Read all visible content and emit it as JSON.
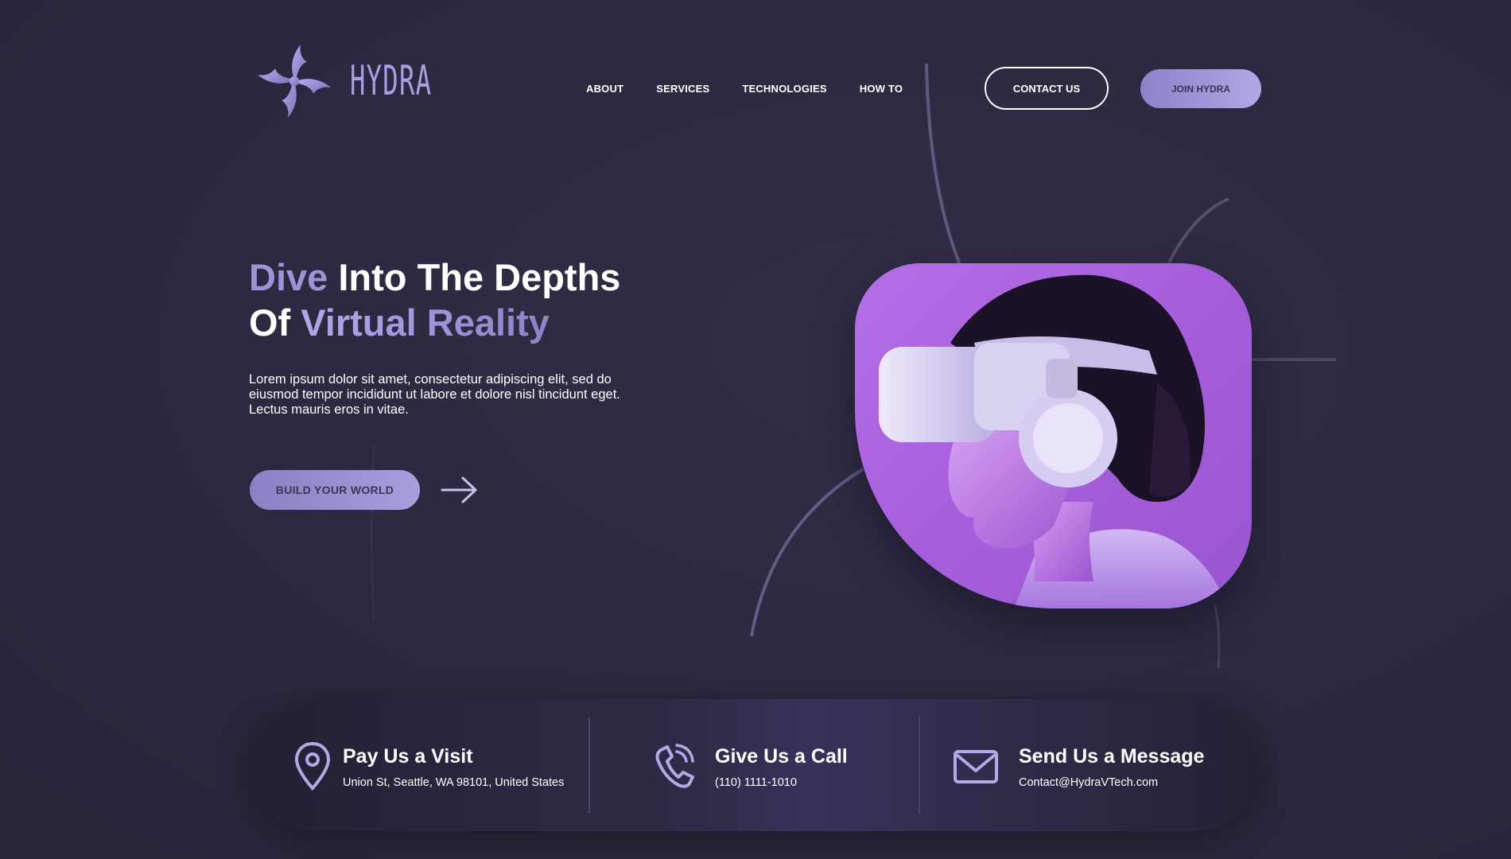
{
  "brand": {
    "name": "HYDRA",
    "logo_icon": "hydra-swirl-icon"
  },
  "nav": {
    "items": [
      "ABOUT",
      "SERVICES",
      "TECHNOLOGIES",
      "HOW TO"
    ]
  },
  "header": {
    "contact_label": "CONTACT US",
    "join_label": "JOIN HYDRA"
  },
  "hero": {
    "title_line1_accent": "Dive",
    "title_line1_rest": " Into The Depths",
    "title_line2_start": "Of ",
    "title_line2_accent": "Virtual Reality",
    "description": "Lorem ipsum dolor sit amet, consectetur adipiscing elit, sed do eiusmod tempor incididunt ut labore et dolore nisl tincidunt eget. Lectus mauris eros in vitae.",
    "cta_label": "BUILD YOUR WORLD",
    "arrow_icon": "arrow-right-icon",
    "image_subject": "vr-headset-person-image"
  },
  "contact": {
    "items": [
      {
        "icon": "location-pin-icon",
        "title": "Pay Us a Visit",
        "detail": "Union St, Seattle, WA 98101, United States"
      },
      {
        "icon": "phone-icon",
        "title": "Give Us a Call",
        "detail": "(110) 1111-1010"
      },
      {
        "icon": "envelope-icon",
        "title": "Send Us a Message",
        "detail": "Contact@HydraVTech.com"
      }
    ]
  },
  "colors": {
    "background": "#2c2a3f",
    "accent": "#9f93d6",
    "button_fill": "#a79fdc",
    "image_bg": "#b46fe6"
  }
}
